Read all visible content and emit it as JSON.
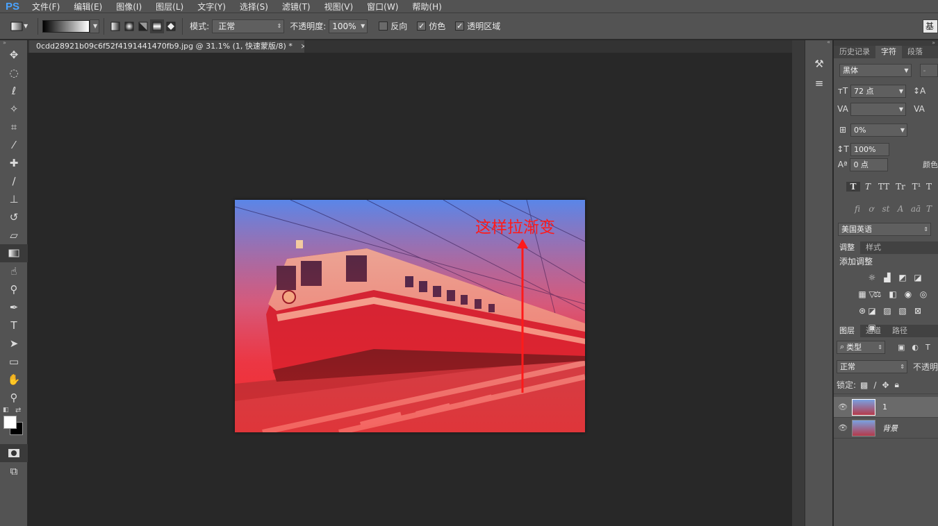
{
  "app": {
    "logo": "PS"
  },
  "menu": [
    "文件(F)",
    "编辑(E)",
    "图像(I)",
    "图层(L)",
    "文字(Y)",
    "选择(S)",
    "滤镜(T)",
    "视图(V)",
    "窗口(W)",
    "帮助(H)"
  ],
  "options": {
    "mode_label": "模式:",
    "mode_value": "正常",
    "opacity_label": "不透明度:",
    "opacity_value": "100%",
    "reverse_label": "反向",
    "dither_label": "仿色",
    "transparency_label": "透明区域",
    "workspace_label": "基"
  },
  "document": {
    "tab_title": "0cdd28921b09c6f52f4191441470fb9.jpg @ 31.1% (1, 快速蒙版/8) *",
    "close_symbol": "×",
    "annotation": "这样拉渐变"
  },
  "char_panel": {
    "tabs": [
      "历史记录",
      "字符",
      "段落"
    ],
    "font_family": "黑体",
    "font_style": "-",
    "font_size": "72 点",
    "tracking": "0%",
    "vscale": "100%",
    "baseline": "0 点",
    "color_label": "颜色",
    "language": "美国英语",
    "type_styles": [
      "T",
      "T",
      "TT",
      "Tr",
      "T¹",
      "T"
    ],
    "ot_styles": [
      "fi",
      "ơ",
      "st",
      "A",
      "aā",
      "T"
    ]
  },
  "adjust_panel": {
    "tabs": [
      "调整",
      "样式"
    ],
    "title": "添加调整"
  },
  "layers_panel": {
    "tabs": [
      "图层",
      "通道",
      "路径"
    ],
    "filter": "类型",
    "blend": "正常",
    "opacity_label": "不透明",
    "lock_label": "锁定:",
    "layers": [
      {
        "name": "1"
      },
      {
        "name": "背景"
      }
    ]
  },
  "colors": {
    "annotation": "#ff1a1a",
    "accent": "#4aa3ff"
  },
  "icons": {
    "tools": [
      "move-icon",
      "marquee-icon",
      "lasso-icon",
      "magic-wand-icon",
      "crop-icon",
      "eyedropper-icon",
      "healing-icon",
      "brush-icon",
      "stamp-icon",
      "history-brush-icon",
      "eraser-icon",
      "gradient-icon",
      "smudge-icon",
      "dodge-icon",
      "pen-icon",
      "type-icon",
      "path-select-icon",
      "shape-icon",
      "hand-icon",
      "zoom-icon"
    ]
  }
}
